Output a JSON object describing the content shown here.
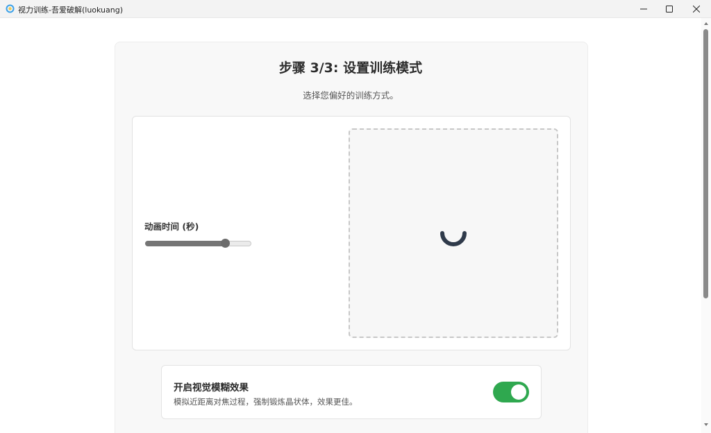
{
  "window": {
    "title": "视力训练-吾爱破解(luokuang)",
    "icon": "app-logo-icon",
    "controls": [
      "minimize-icon",
      "maximize-icon",
      "close-icon"
    ]
  },
  "page": {
    "title": "步骤 3/3: 设置训练模式",
    "subtitle": "选择您偏好的训练方式。"
  },
  "animation": {
    "label": "动画时间 (秒)",
    "slider_fraction": 0.78
  },
  "preview": {
    "icon": "loading-spinner-icon",
    "spinner_color": "#2f3a4a"
  },
  "blur": {
    "title": "开启视觉模糊效果",
    "description": "模拟近距离对焦过程，强制锻炼晶状体，效果更佳。",
    "enabled": true
  },
  "colors": {
    "toggle_on": "#2fa84f"
  }
}
